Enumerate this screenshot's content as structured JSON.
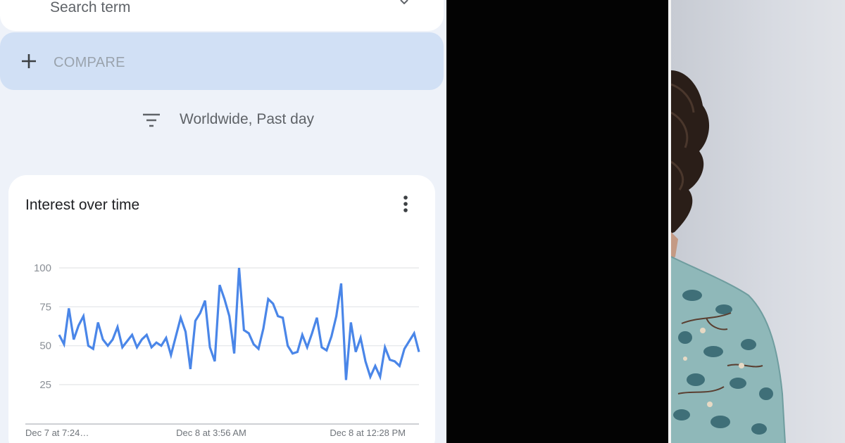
{
  "search": {
    "placeholder": "Search term"
  },
  "compare": {
    "label": "COMPARE"
  },
  "filter": {
    "label": "Worldwide, Past day"
  },
  "chart_card": {
    "title": "Interest over time"
  },
  "icons": {
    "dropdown": "chevron-down-icon",
    "add": "plus-icon",
    "filter": "filter-icon",
    "more": "more-vert-icon"
  },
  "colors": {
    "line": "#4a86e8",
    "compare_bg": "#d1e0f5",
    "page_bg": "#eef2f9"
  },
  "chart_data": {
    "type": "line",
    "title": "Interest over time",
    "xlabel": "",
    "ylabel": "",
    "ylim": [
      10,
      100
    ],
    "y_ticks": [
      100,
      75,
      50,
      25
    ],
    "x_tick_labels": [
      "Dec 7 at 7:24…",
      "Dec 8 at 3:56 AM",
      "Dec 8 at 12:28 PM"
    ],
    "grid": true,
    "series": [
      {
        "values": [
          57,
          51,
          74,
          54,
          63,
          69,
          50,
          48,
          65,
          54,
          50,
          54,
          62,
          49,
          53,
          57,
          49,
          54,
          57,
          49,
          52,
          50,
          55,
          44,
          56,
          68,
          59,
          35,
          66,
          71,
          79,
          49,
          40,
          89,
          80,
          69,
          45,
          100,
          60,
          58,
          51,
          48,
          61,
          80,
          77,
          69,
          68,
          50,
          45,
          46,
          57,
          49,
          58,
          68,
          49,
          47,
          56,
          69,
          90,
          28,
          65,
          46,
          55,
          40,
          30,
          37,
          30,
          49,
          41,
          40,
          37,
          48,
          53,
          58,
          46
        ]
      }
    ]
  }
}
